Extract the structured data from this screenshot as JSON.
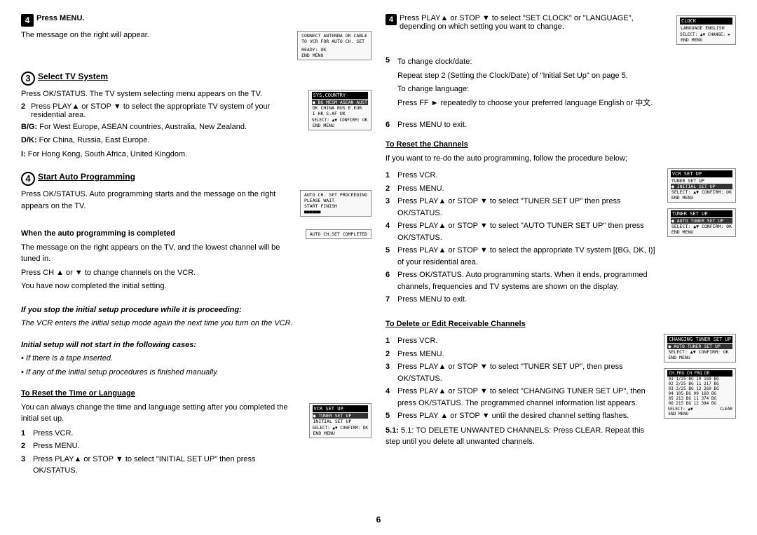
{
  "page": {
    "number": "6"
  },
  "left_col": {
    "step4_press_menu": {
      "label": "4",
      "text": "Press MENU.",
      "sub": "The message on the right will appear."
    },
    "step3_select_tv": {
      "label": "3",
      "title": "Select TV System",
      "step1": "Press OK/STATUS. The TV system selecting menu appears on the TV.",
      "step2_label": "2",
      "step2_text": "Press PLAY▲ or STOP ▼ to select the appropriate TV system of your residential area.",
      "bg_label": "B/G:",
      "bg_text": "For West Europe, ASEAN countries, Australia, New Zealand.",
      "dk_label": "D/K:",
      "dk_text": "For China, Russia, East Europe.",
      "i_label": "I:",
      "i_text": "For Hong Kong, South Africa, United Kingdom."
    },
    "step4_auto_prog": {
      "label": "4",
      "title": "Start Auto Programming",
      "desc": "Press OK/STATUS. Auto programming starts and the message on the right appears on the TV."
    },
    "when_completed": {
      "title": "When the auto programming is completed",
      "text1": "The message on the right appears on the TV, and the lowest channel will be tuned in.",
      "text2": "Press CH ▲ or ▼ to change channels on the VCR.",
      "text3": "You have now completed the initial setting."
    },
    "if_stop": {
      "italic_title": "If you stop the initial setup procedure while it is proceeding:",
      "italic_text": "The VCR enters the initial setup mode again the next time you turn on the VCR."
    },
    "initial_setup": {
      "italic_title": "Initial setup will not start in the following cases:",
      "bullet1": "• If there is a tape inserted.",
      "bullet2": "• If any of the initial setup procedures is finished manually."
    },
    "to_reset_time": {
      "title": "To Reset the Time or Language",
      "text": "You can always change the time and language setting after you completed the initial set up.",
      "step1": "Press VCR.",
      "step2": "Press MENU.",
      "step3_label": "3",
      "step3_text": "Press PLAY▲ or STOP ▼ to select \"INITIAL SET UP\" then press OK/STATUS."
    }
  },
  "right_col": {
    "step4_top": {
      "label": "4",
      "text": "Press PLAY▲ or STOP ▼ to select \"SET CLOCK\" or \"LANGUAGE\", depending on which setting you want to change."
    },
    "step5": {
      "label": "5",
      "title": "To change clock/date:",
      "text": "Repeat step 2 (Setting the Clock/Date) of \"Initial Set Up\" on page 5.",
      "lang_title": "To change language:",
      "lang_text": "Press FF ► repeatedly to choose your preferred language English or 中文."
    },
    "step6": {
      "label": "6",
      "text": "Press MENU to exit."
    },
    "to_reset_channels": {
      "title": "To Reset the Channels",
      "intro": "If you want to re-do the auto programming, follow the procedure below;",
      "step1": "Press VCR.",
      "step2": "Press MENU.",
      "step3_text": "Press PLAY▲ or STOP ▼ to select \"TUNER SET UP\" then press OK/STATUS.",
      "step4_text": "Press PLAY▲ or STOP ▼ to select \"AUTO TUNER SET UP\" then press OK/STATUS.",
      "step5_text": "Press PLAY▲ or STOP ▼ to select the appropriate TV system [(BG, DK, I)] of your residential area.",
      "step6_text": "Press OK/STATUS. Auto programming starts. When it ends, programmed channels, frequencies and TV systems are shown on the display.",
      "step7_text": "Press MENU to exit."
    },
    "to_delete": {
      "title": "To Delete or Edit Receivable Channels",
      "step1": "Press VCR.",
      "step2": "Press MENU.",
      "step3_text": "Press PLAY▲ or STOP ▼ to select \"TUNER SET UP\", then press OK/STATUS.",
      "step4_text": "Press PLAY▲ or STOP ▼ to select \"CHANGING TUNER SET UP\", then press OK/STATUS. The programmed channel information list appears.",
      "step5_intro": "Press PLAY ▲ or STOP ▼ until the desired channel setting flashes.",
      "step5_1": "5.1: TO DELETE UNWANTED CHANNELS: Press CLEAR. Repeat this step until you delete all unwanted channels."
    }
  },
  "screens": {
    "connect_antenna": {
      "line1": "CONNECT ANTENNA OR CABLE",
      "line2": "TO VCR FOR AUTO CH. SET",
      "line3": "READY: OK",
      "line4": "END MENU"
    },
    "sys_country": {
      "title": "SYS.COUNTRY",
      "row1": "● BG  MESM  ASEAN  AUST",
      "row2": "   DK  CHINA  RUS  E.EUR",
      "row3": "   I   HK  S.AF   UK",
      "select": "SELECT: ▲▼  CONFIRM: OK",
      "end": "END MENU"
    },
    "auto_ch_proceeding": {
      "line1": "AUTO CH. SET PROCEEDING",
      "line2": "PLEASE WAIT",
      "line3": "START    FINISH",
      "progress": "■■■■■■"
    },
    "auto_ch_completed": {
      "line1": "AUTO CH.SET COMPLETED"
    },
    "vcr_set_up": {
      "title": "VCR SET UP",
      "row1": "● TUNER SET UP",
      "row2": "  INITIAL SET UP",
      "select": "SELECT: ▲▼  CONFIRM: OK",
      "end": "END MENU"
    },
    "clock_language": {
      "title": "CLOCK",
      "row1": "LANGUAGE  ENGLISH",
      "select": "SELECT: ▲▼  CHANGE: ►",
      "end": "END MENU"
    },
    "vcr_set_up2": {
      "title": "VCR SET UP",
      "row1": "  TUNER SET UP",
      "row2": "● INITIAL SET UP",
      "select": "SELECT: ▲▼  CONFIRM: OK",
      "end": "END MENU"
    },
    "tuner_set_up": {
      "title": "TUNER SET UP",
      "row1": "● AUTO TUNER SET UP",
      "select": "SELECT: ▲▼  CONFIRM: OK",
      "end": "END MENU"
    },
    "changing_tuner": {
      "title": "CHANGING TUNER SET UP",
      "row1": "● AUTO TUNER SET UP",
      "select": "SELECT: ▲▼  CONFIRM: OK",
      "end": "END MENU"
    },
    "channel_list": {
      "title": "CH.PRG  CH  FRQ  DR",
      "rows": [
        "01 1/25  BG  10  169  BG",
        "02 2/25  BG  11  217  BG",
        "03 3/25  BG  12  269  BG",
        "04 105   BG  09  160  BG",
        "05 213   BG  11  374  BG",
        "06 215   BG  12  394  BG"
      ],
      "select": "SELECT: ▲▼",
      "clear": "CLEAR",
      "end": "END MENU"
    }
  }
}
